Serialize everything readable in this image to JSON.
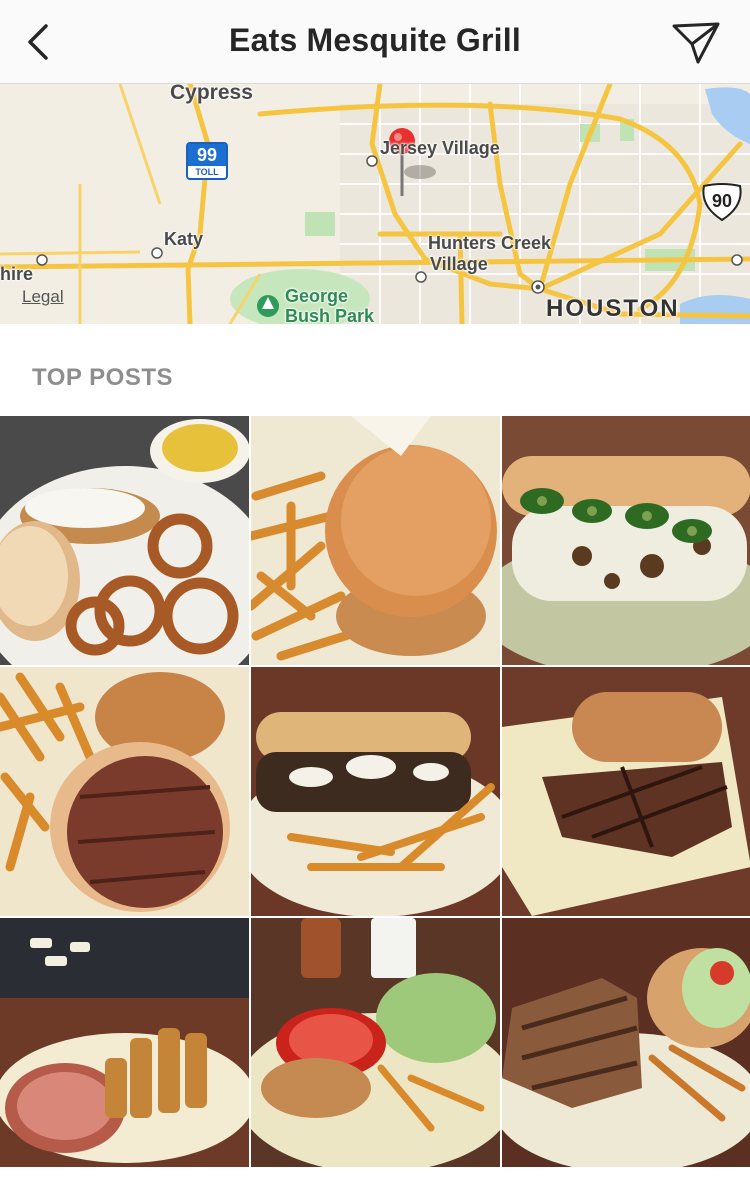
{
  "header": {
    "title": "Eats Mesquite Grill",
    "back_icon": "chevron-left-icon",
    "share_icon": "paper-plane-icon"
  },
  "map": {
    "labels": {
      "cypress": "Cypress",
      "jersey_village": "Jersey Village",
      "katy": "Katy",
      "hunters_creek_1": "Hunters Creek",
      "hunters_creek_2": "Village",
      "houston": "Houston",
      "shire": "hire",
      "george_bush_1": "George",
      "george_bush_2": "Bush Park"
    },
    "legal": "Legal",
    "highway_99": "99",
    "toll": "TOLL",
    "highway_90": "90",
    "pin_color": "#e8312f"
  },
  "top_posts": {
    "title": "TOP POSTS",
    "posts": [
      {
        "subject": "chicken fried steak, onion rings, corn"
      },
      {
        "subject": "burger with fries"
      },
      {
        "subject": "cheesesteak with jalapenos"
      },
      {
        "subject": "burger with steak patty and fries"
      },
      {
        "subject": "cheesesteak sandwich with fries"
      },
      {
        "subject": "grilled steak sandwich"
      },
      {
        "subject": "ham and french toast"
      },
      {
        "subject": "burger with tomato and lettuce, fries"
      },
      {
        "subject": "grilled chicken with burger"
      }
    ]
  }
}
